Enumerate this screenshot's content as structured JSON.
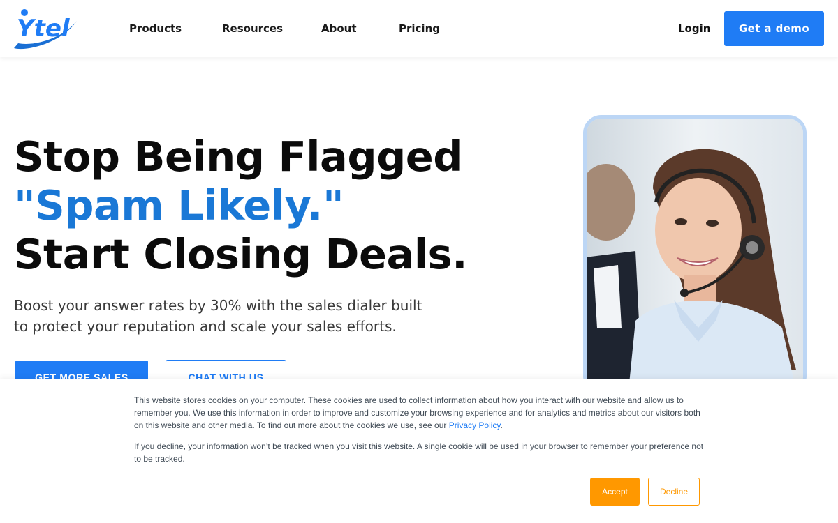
{
  "brand": {
    "logo_text": "Ytel",
    "accent_color": "#1f7cf5",
    "headline_accent_color": "#1a78d6"
  },
  "nav": {
    "items": [
      {
        "label": "Products"
      },
      {
        "label": "Resources"
      },
      {
        "label": "About"
      },
      {
        "label": "Pricing"
      }
    ],
    "login_label": "Login",
    "demo_label": "Get a demo"
  },
  "hero": {
    "headline_line1": "Stop Being Flagged",
    "headline_line2": "\"Spam Likely.\"",
    "headline_line3": "Start Closing Deals.",
    "subtext": "Boost your answer rates by 30% with the sales dialer built to protect your reputation and scale your sales efforts.",
    "primary_cta": "GET MORE SALES",
    "secondary_cta": "CHAT WITH US",
    "image_icon": "agent-photo"
  },
  "cookie_banner": {
    "paragraph1": "This website stores cookies on your computer. These cookies are used to collect information about how you interact with our website and allow us to remember you. We use this information in order to improve and customize your browsing experience and for analytics and metrics about our visitors both on this website and other media. To find out more about the cookies we use, see our",
    "privacy_link": "Privacy Policy",
    "paragraph1_end": ".",
    "paragraph2": "If you decline, your information won’t be tracked when you visit this website. A single cookie will be used in your browser to remember your preference not to be tracked.",
    "accept_label": "Accept",
    "decline_label": "Decline",
    "accept_color": "#ff9800"
  }
}
